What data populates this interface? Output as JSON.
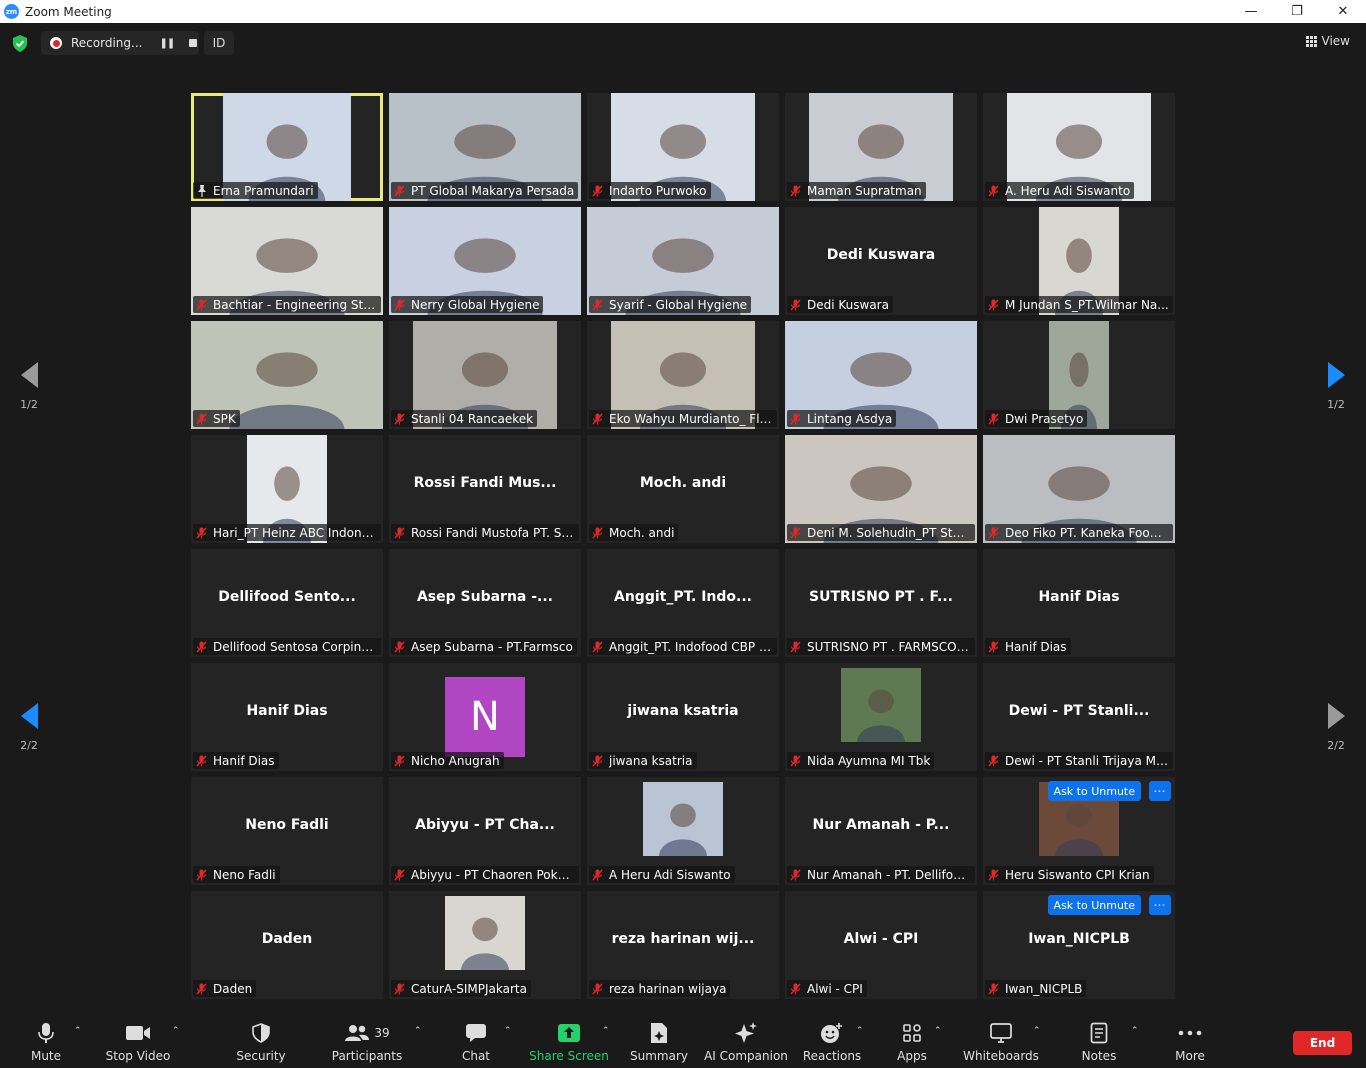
{
  "window": {
    "title": "Zoom Meeting",
    "app_logo": "zm"
  },
  "topbar": {
    "recording_label": "Recording...",
    "id_label": "ID",
    "view_label": "View"
  },
  "pages": {
    "left_top": "1/2",
    "left_bottom": "2/2",
    "right_top": "1/2",
    "right_bottom": "2/2"
  },
  "participants_count": "39",
  "colors": {
    "active_border": "#e2ed7a",
    "unmute_blue": "#0e72ed",
    "end_red": "#e02828",
    "share_green": "#24d16c"
  },
  "tiles": [
    {
      "name": "Erna Pramundari",
      "big": "",
      "kind": "video",
      "vw": 128,
      "bg": "#cfd8e6",
      "pinned": true,
      "active": true
    },
    {
      "name": "PT Global Makarya Persada",
      "big": "",
      "kind": "video",
      "vw": 192,
      "bg": "#b8c0c8"
    },
    {
      "name": "Indarto Purwoko",
      "big": "",
      "kind": "video",
      "vw": 144,
      "bg": "#d7dde6"
    },
    {
      "name": "Maman Supratman",
      "big": "",
      "kind": "video",
      "vw": 144,
      "bg": "#c9ccd2"
    },
    {
      "name": "A. Heru Adi Siswanto",
      "big": "",
      "kind": "video",
      "vw": 144,
      "bg": "#e3e4e8"
    },
    {
      "name": "Bachtiar - Engineering Stanli",
      "big": "",
      "kind": "video",
      "vw": 192,
      "bg": "#d9d9d6"
    },
    {
      "name": "Nerry Global Hygiene",
      "big": "",
      "kind": "video",
      "vw": 192,
      "bg": "#c8d0e2"
    },
    {
      "name": "Syarif - Global Hygiene",
      "big": "",
      "kind": "video",
      "vw": 192,
      "bg": "#c5ccd8"
    },
    {
      "name": "Dedi Kuswara",
      "big": "Dedi Kuswara",
      "kind": "name"
    },
    {
      "name": "M Jundan S_PT.Wilmar Na...",
      "big": "",
      "kind": "video",
      "vw": 80,
      "bg": "#d8d8d0"
    },
    {
      "name": "SPK",
      "big": "",
      "kind": "video",
      "vw": 192,
      "bg": "#bfc3b8"
    },
    {
      "name": "Stanli 04 Rancaekek",
      "big": "",
      "kind": "video",
      "vw": 144,
      "bg": "#b0aea8"
    },
    {
      "name": "Eko Wahyu Murdianto_ Flo...",
      "big": "",
      "kind": "video",
      "vw": 144,
      "bg": "#c5c0b5"
    },
    {
      "name": "Lintang Asdya",
      "big": "",
      "kind": "video",
      "vw": 192,
      "bg": "#c6cfe0"
    },
    {
      "name": "Dwi Prasetyo",
      "big": "",
      "kind": "video",
      "vw": 60,
      "bg": "#9ea89a"
    },
    {
      "name": "Hari_PT Heinz ABC Indonesia",
      "big": "",
      "kind": "video",
      "vw": 80,
      "bg": "#e6e8ec"
    },
    {
      "name": "Rossi Fandi Mustofa PT. Su...",
      "big": "Rossi Fandi Mus...",
      "kind": "name"
    },
    {
      "name": "Moch. andi",
      "big": "Moch. andi",
      "kind": "name"
    },
    {
      "name": "Deni M. Solehudin_PT Stanl...",
      "big": "",
      "kind": "video",
      "vw": 192,
      "bg": "#cbc7c0"
    },
    {
      "name": "Deo Fiko PT. Kaneka Foods...",
      "big": "",
      "kind": "video",
      "vw": 192,
      "bg": "#bbbdc0"
    },
    {
      "name": "Dellifood Sentosa Corpind...",
      "big": "Dellifood  Sento...",
      "kind": "name"
    },
    {
      "name": "Asep Subarna - PT.Farmsco",
      "big": "Asep Subarna -...",
      "kind": "name"
    },
    {
      "name": "Anggit_PT. Indofood CBP S...",
      "big": "Anggit_PT.  Indo...",
      "kind": "name"
    },
    {
      "name": "SUTRISNO PT . FARMSCO F...",
      "big": "SUTRISNO PT . F...",
      "kind": "name"
    },
    {
      "name": "Hanif Dias",
      "big": "Hanif Dias",
      "kind": "name"
    },
    {
      "name": "Hanif Dias",
      "big": "Hanif Dias",
      "kind": "name"
    },
    {
      "name": "Nicho Anugrah",
      "big": "N",
      "kind": "avatar"
    },
    {
      "name": "jiwana ksatria",
      "big": "jiwana ksatria",
      "kind": "name"
    },
    {
      "name": "Nida Ayumna MI Tbk",
      "big": "",
      "kind": "video",
      "vw": 80,
      "bh": 74,
      "bg": "#5e7a52"
    },
    {
      "name": "Dewi  - PT Stanli Trijaya Ma...",
      "big": "Dewi  - PT Stanli...",
      "kind": "name"
    },
    {
      "name": "Neno Fadli",
      "big": "Neno Fadli",
      "kind": "name"
    },
    {
      "name": "Abiyyu - PT Chaoren Pokph...",
      "big": "Abiyyu  - PT Cha...",
      "kind": "name"
    },
    {
      "name": "A Heru Adi Siswanto",
      "big": "",
      "kind": "video",
      "vw": 80,
      "bh": 74,
      "bg": "#b9c4d4"
    },
    {
      "name": "Nur Amanah - PT. Dellifoo...",
      "big": "Nur Amanah - P...",
      "kind": "name"
    },
    {
      "name": "Heru Siswanto CPI Krian",
      "big": "",
      "kind": "video",
      "vw": 80,
      "bh": 74,
      "bg": "#6b4a3a",
      "unmute": true
    },
    {
      "name": "Daden",
      "big": "Daden",
      "kind": "name"
    },
    {
      "name": "CaturA-SIMPJakarta",
      "big": "",
      "kind": "video",
      "vw": 80,
      "bh": 74,
      "bg": "#d9d6d2"
    },
    {
      "name": "reza harinan wijaya",
      "big": "reza  harinan  wij...",
      "kind": "name"
    },
    {
      "name": "Alwi - CPI",
      "big": "Alwi - CPI",
      "kind": "name"
    },
    {
      "name": "Iwan_NICPLB",
      "big": "Iwan_NICPLB",
      "kind": "name",
      "unmute": true
    }
  ],
  "ask_to_unmute": "Ask to Unmute",
  "toolbar": {
    "mute": "Mute",
    "stop_video": "Stop Video",
    "security": "Security",
    "participants": "Participants",
    "chat": "Chat",
    "share_screen": "Share Screen",
    "summary": "Summary",
    "ai_companion": "AI Companion",
    "reactions": "Reactions",
    "apps": "Apps",
    "whiteboards": "Whiteboards",
    "notes": "Notes",
    "more": "More",
    "end": "End"
  }
}
